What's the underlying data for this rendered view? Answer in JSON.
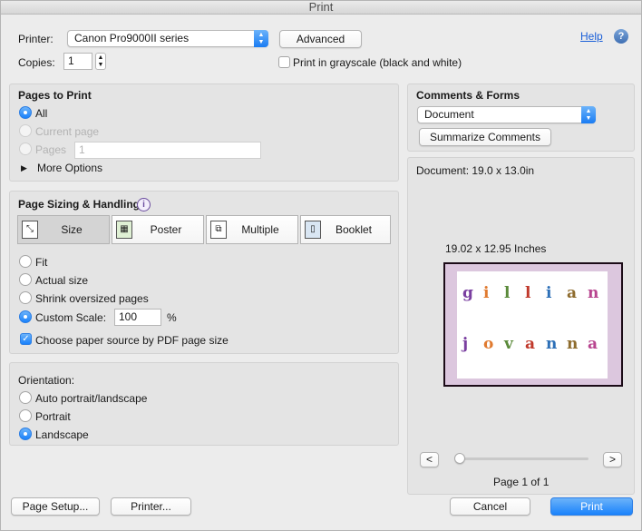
{
  "window": {
    "title": "Print"
  },
  "printer": {
    "label": "Printer:",
    "selected": "Canon Pro9000II series",
    "advanced_label": "Advanced",
    "help_label": "Help",
    "copies_label": "Copies:",
    "copies_value": "1",
    "grayscale_label": "Print in grayscale (black and white)",
    "grayscale_checked": false
  },
  "pages_to_print": {
    "title": "Pages to Print",
    "options": [
      "All",
      "Current page",
      "Pages"
    ],
    "selected": "All",
    "pages_value": "1",
    "more_options_label": "More Options"
  },
  "page_sizing": {
    "title": "Page Sizing & Handling",
    "modes": [
      "Size",
      "Poster",
      "Multiple",
      "Booklet"
    ],
    "active_mode": "Size",
    "size_options": [
      "Fit",
      "Actual size",
      "Shrink oversized pages",
      "Custom Scale:"
    ],
    "selected": "Custom Scale:",
    "custom_scale_value": "100",
    "custom_scale_unit": "%",
    "paper_source_label": "Choose paper source by PDF page size",
    "paper_source_checked": true
  },
  "orientation": {
    "title": "Orientation:",
    "options": [
      "Auto portrait/landscape",
      "Portrait",
      "Landscape"
    ],
    "selected": "Landscape"
  },
  "comments_forms": {
    "title": "Comments & Forms",
    "selected": "Document",
    "summarize_label": "Summarize Comments"
  },
  "preview": {
    "document_size": "Document: 19.0 x 13.0in",
    "paper_size": "19.02 x 12.95 Inches",
    "prev_label": "<",
    "next_label": ">",
    "page_indicator": "Page 1 of 1",
    "slider_position": 0,
    "content_row1": [
      "g",
      "i",
      "l",
      "l",
      "i",
      "a",
      "n"
    ],
    "content_row2": [
      "j",
      "o",
      "v",
      "a",
      "n",
      "n",
      "a"
    ]
  },
  "footer": {
    "page_setup_label": "Page Setup...",
    "printer_label": "Printer...",
    "cancel_label": "Cancel",
    "print_label": "Print"
  },
  "colors": {
    "accent": "#1a82fb",
    "preview_border": "#dcc7de"
  }
}
